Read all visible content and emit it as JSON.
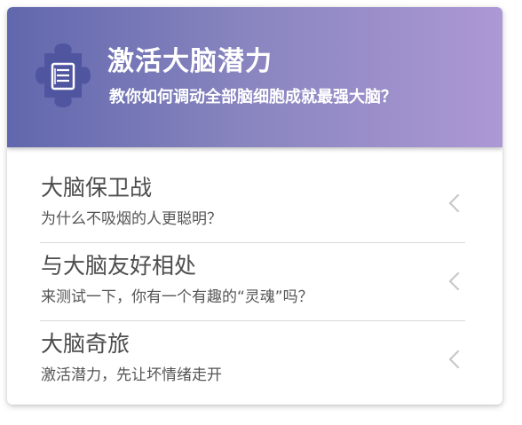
{
  "header": {
    "title": "激活大脑潜力",
    "subtitle": "教你如何调动全部脑细胞成就最强大脑？",
    "icon": "puzzle-document-icon"
  },
  "items": [
    {
      "title": "大脑保卫战",
      "subtitle": "为什么不吸烟的人更聪明？"
    },
    {
      "title": "与大脑友好相处",
      "subtitle": "来测试一下，你有一个有趣的“灵魂”吗？"
    },
    {
      "title": "大脑奇旅",
      "subtitle": "激活潜力，先让坏情绪走开"
    }
  ],
  "colors": {
    "header_gradient_start": "#6167ad",
    "header_gradient_end": "#ac98d4",
    "icon_fill": "#5055a0",
    "chevron": "#c8c8c8"
  }
}
